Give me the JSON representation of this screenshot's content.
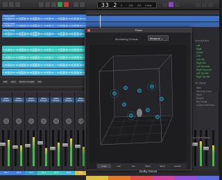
{
  "control_bar": {
    "position": "33 2",
    "position_sub": "3",
    "tempo": "126",
    "key": "Cmaj",
    "signature": "4/4"
  },
  "tracks": {
    "regions": [
      {
        "label": "Verse Guide",
        "color": "#3f7fe0"
      },
      {
        "label": "Verse Guide",
        "color": "#3f7fe0"
      },
      {
        "label": "Verse Guide",
        "color": "#2f9fd0"
      },
      {
        "label": "",
        "color": "#35c7c0"
      },
      {
        "label": "",
        "color": "#35c7c0"
      },
      {
        "label": "",
        "color": "#3fb7e0"
      },
      {
        "label": "",
        "color": "#3fb7e0"
      },
      {
        "label": "",
        "color": "#36a8e8"
      }
    ]
  },
  "inspector": {
    "tab_edit": "Edit",
    "tab_view": "View",
    "tab_send": "Sends on Fader",
    "tab_off": "Off"
  },
  "mixer": {
    "strips": [
      {
        "name": "Vox 1",
        "plugin": "Space Designer",
        "color": "#3f7fe0"
      },
      {
        "name": "Vox 2",
        "plugin": "Space Designer",
        "color": "#3f7fe0"
      },
      {
        "name": "Vox 3",
        "plugin": "Space Designer",
        "color": "#2f9fd0"
      },
      {
        "name": "Vox 4",
        "plugin": "Space Designer",
        "color": "#35c7c0"
      },
      {
        "name": "Vox 5",
        "plugin": "Space Designer",
        "color": "#35c7c0"
      },
      {
        "name": "Vox 6",
        "plugin": "Space Designer",
        "color": "#3fb7e0"
      },
      {
        "name": "Vox 7",
        "plugin": "Space Designer",
        "color": "#e0c03f"
      }
    ],
    "right_strips": [
      {
        "color": "#e0c03f"
      },
      {
        "color": "#e37b2e"
      },
      {
        "color": "#e04d4d"
      },
      {
        "color": "#d146a4"
      },
      {
        "color": "#9552d8"
      },
      {
        "color": "#5a6be0"
      }
    ]
  },
  "panner": {
    "title": "Panner",
    "monitoring_label": "Monitoring Format:",
    "monitoring_value": "Binaural",
    "view_tabs": [
      "Angle",
      "Left",
      "Top",
      "Right",
      "Back",
      "Custom"
    ],
    "logo": "Dolby Atmos",
    "objects_header": "Surround Bed",
    "channels_on": [
      "Left",
      "Right",
      "Center",
      "LFE",
      "Left Mid",
      "Right Mid",
      "Left Surround",
      "Right Surround",
      "Left Top Mid",
      "Right Top Mid"
    ],
    "objects_header2": "3D Objects",
    "objects": [
      "Main",
      "Harmony Vocal",
      "Tenor",
      "Sample",
      "Boy Vocals",
      "Custom Soft Piano"
    ],
    "footer": "Input Stem Object"
  }
}
